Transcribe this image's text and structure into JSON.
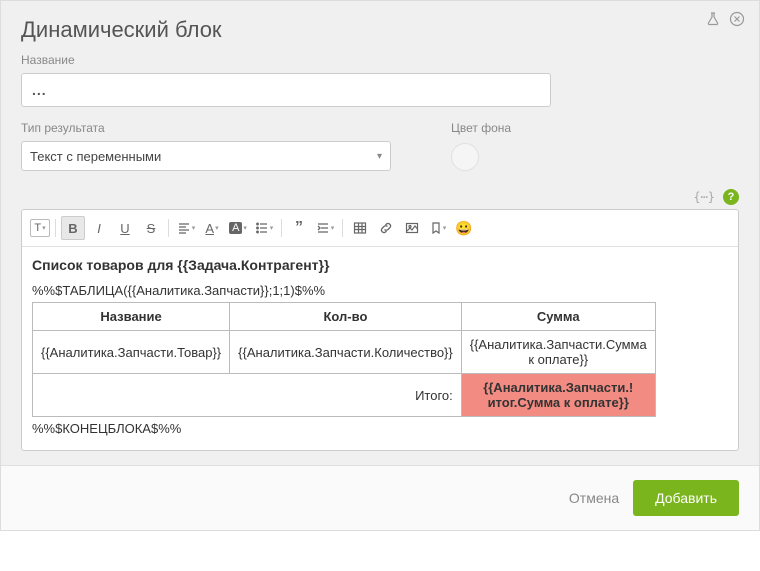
{
  "dialog": {
    "title": "Динамический блок"
  },
  "fields": {
    "name_label": "Название",
    "name_placeholder": "...",
    "result_type_label": "Тип результата",
    "result_type_value": "Текст с переменными",
    "bgcolor_label": "Цвет фона"
  },
  "editor": {
    "heading": "Список товаров для {{Задача.Контрагент}}",
    "line_before": "%%$ТАБЛИЦА({{Аналитика.Запчасти}};1;1)$%%",
    "line_after": "%%$КОНЕЦБЛОКА$%%",
    "table": {
      "headers": [
        "Название",
        "Кол-во",
        "Сумма"
      ],
      "row": [
        "{{Аналитика.Запчасти.Товар}}",
        "{{Аналитика.Запчасти.Количество}}",
        "{{Аналитика.Запчасти.Сумма к оплате}}"
      ],
      "total_label": "Итого:",
      "total_value": "{{Аналитика.Запчасти.!итог.Сумма к оплате}}"
    }
  },
  "footer": {
    "cancel": "Отмена",
    "submit": "Добавить"
  }
}
